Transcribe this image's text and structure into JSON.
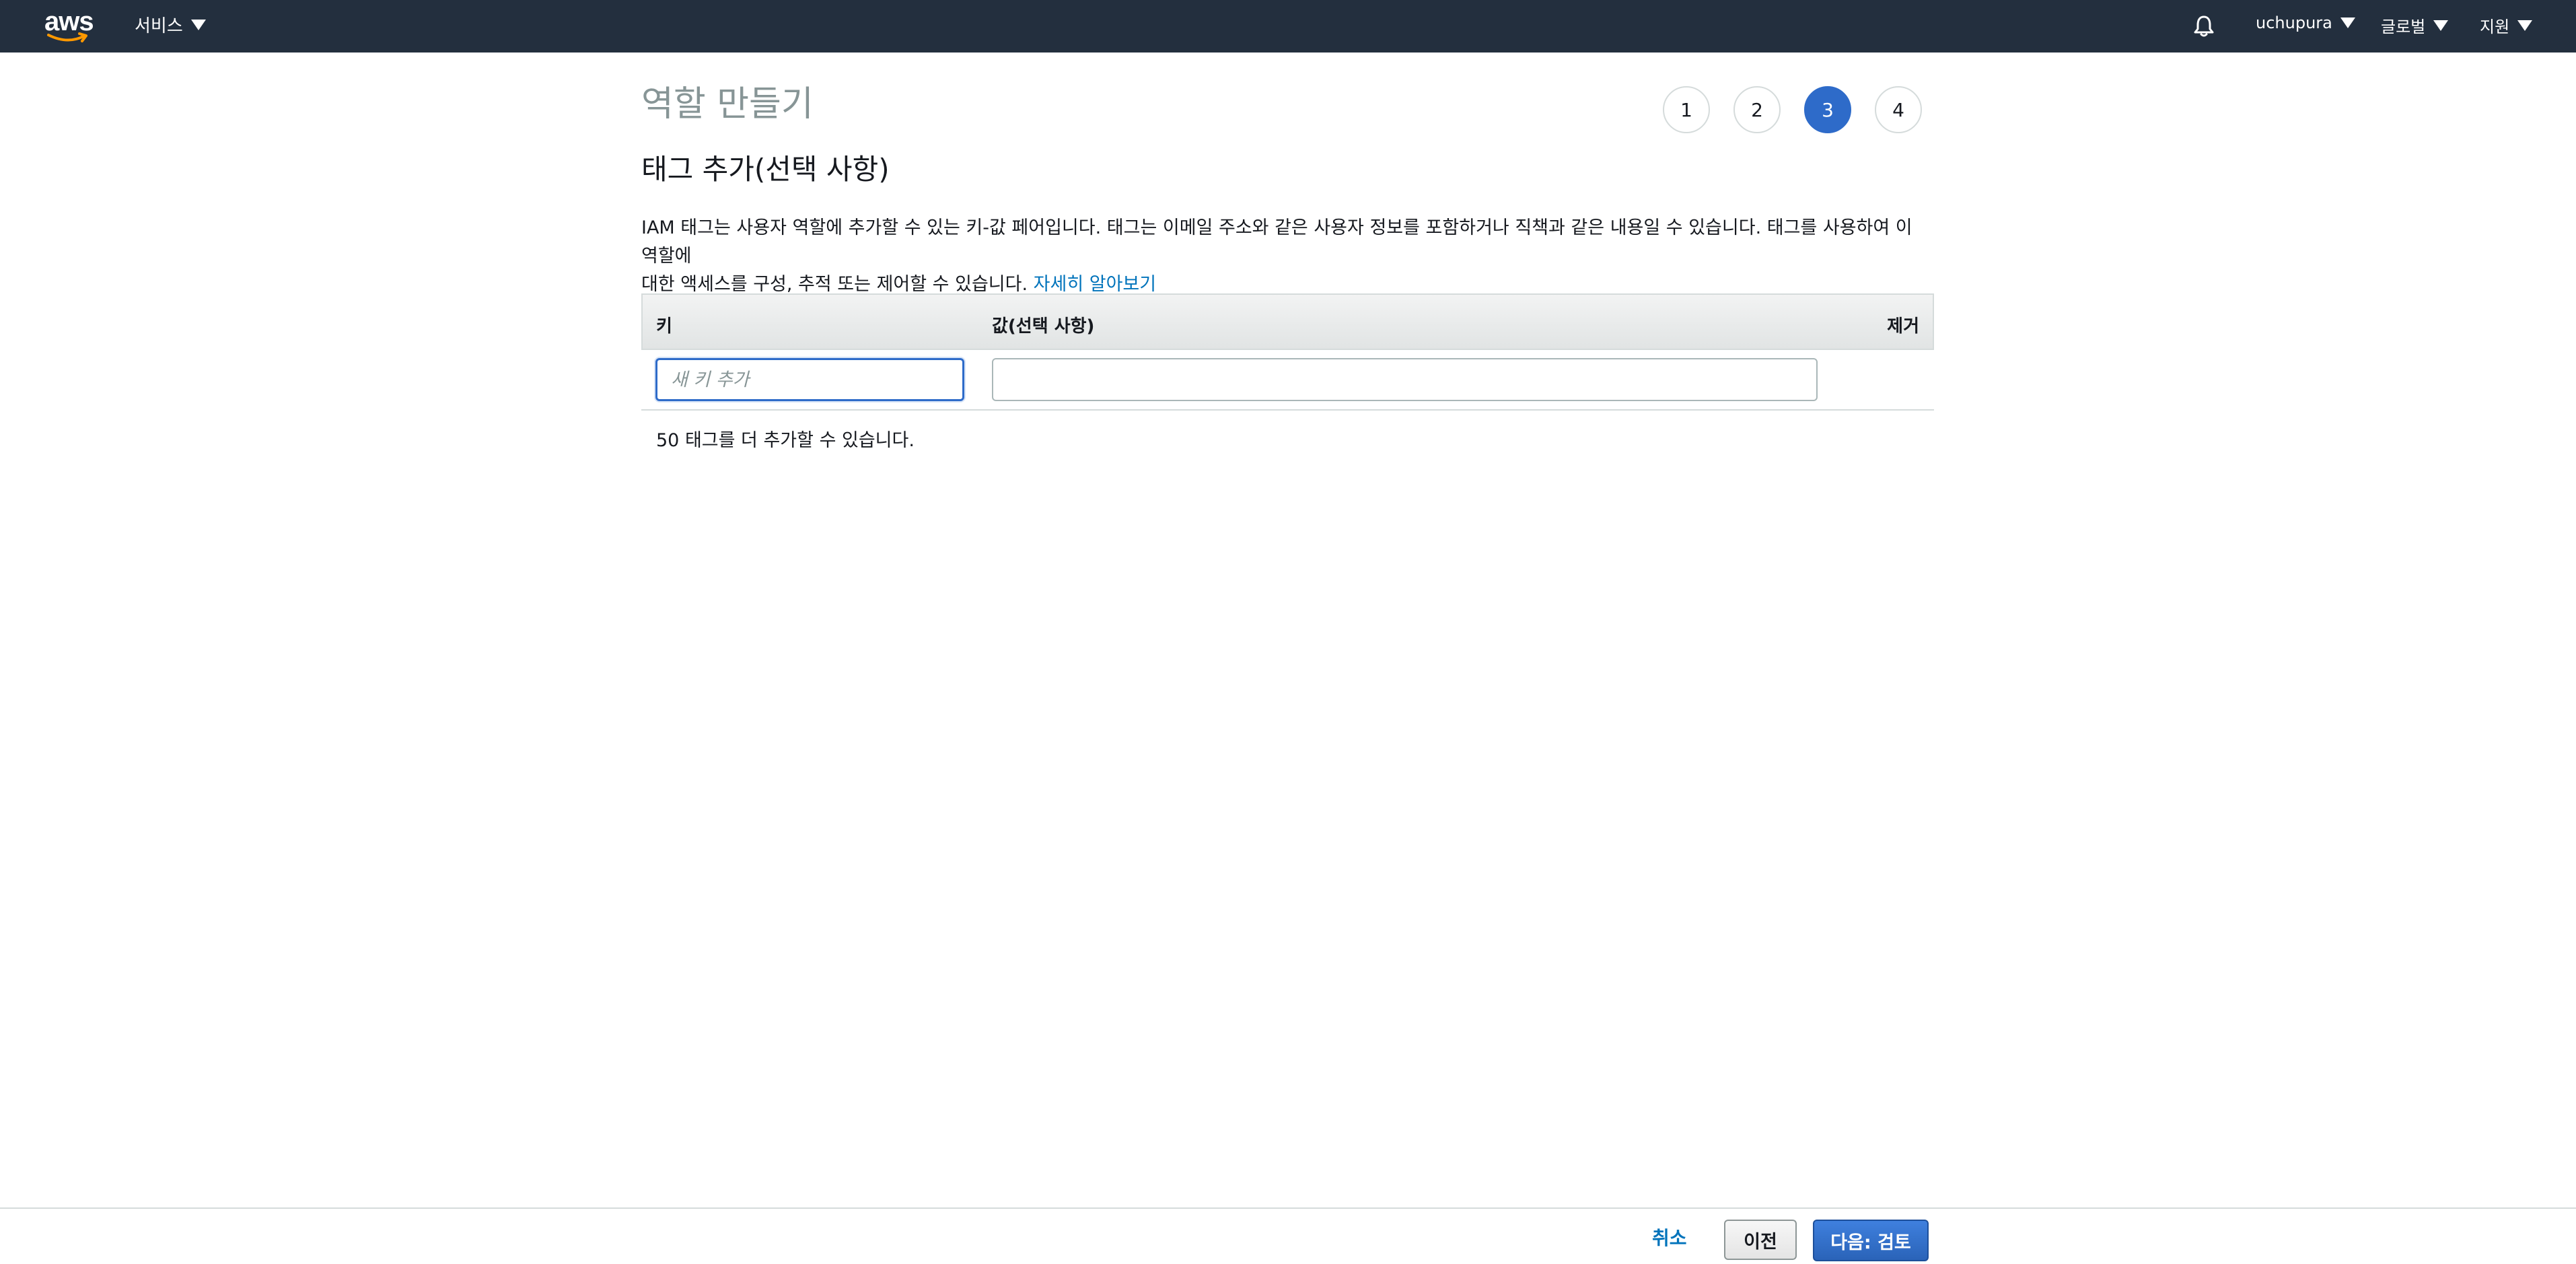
{
  "topnav": {
    "logo_text": "aws",
    "services_label": "서비스",
    "user_label": "uchupura",
    "region_label": "글로벌",
    "support_label": "지원"
  },
  "page": {
    "title": "역할 만들기",
    "steps": [
      "1",
      "2",
      "3",
      "4"
    ],
    "active_step": "3",
    "section_title": "태그 추가(선택 사항)",
    "description_line1": "IAM 태그는 사용자 역할에 추가할 수 있는 키-값 페어입니다. 태그는 이메일 주소와 같은 사용자 정보를 포함하거나 직책과 같은 내용일 수 있습니다. 태그를 사용하여 이 역할에",
    "description_line2": "대한 액세스를 구성, 추적 또는 제어할 수 있습니다.",
    "learn_more": "자세히 알아보기"
  },
  "tag_table": {
    "col_key": "키",
    "col_value": "값(선택 사항)",
    "col_remove": "제거",
    "key_placeholder": "새 키 추가",
    "key_value": "",
    "value_value": "",
    "remaining_text": "50 태그를 더 추가할 수 있습니다."
  },
  "footer": {
    "cancel_label": "취소",
    "prev_label": "이전",
    "next_label": "다음: 검토"
  },
  "colors": {
    "nav_bg": "#232f3e",
    "accent": "#2e6bc9",
    "link": "#0073bb"
  }
}
